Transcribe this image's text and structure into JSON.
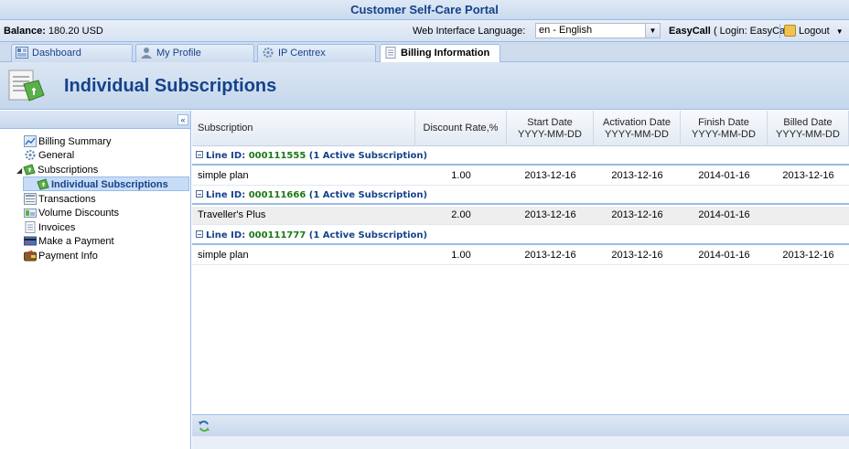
{
  "app": {
    "title": "Customer Self-Care Portal"
  },
  "topbar": {
    "balance_label": "Balance:",
    "balance_value": "180.20 USD",
    "language_label": "Web Interface Language:",
    "language_value": "en - English",
    "user_name": "EasyCall",
    "user_login": "( Login: EasyCall )",
    "logout_label": "Logout"
  },
  "tabs": [
    {
      "label": "Dashboard",
      "active": false
    },
    {
      "label": "My Profile",
      "active": false
    },
    {
      "label": "IP Centrex",
      "active": false
    },
    {
      "label": "Billing Information",
      "active": true
    }
  ],
  "page": {
    "title": "Individual Subscriptions"
  },
  "sidebar": {
    "collapse_label": "«",
    "items": [
      {
        "label": "Billing Summary",
        "icon": "chart-icon"
      },
      {
        "label": "General",
        "icon": "gear-icon"
      },
      {
        "label": "Subscriptions",
        "icon": "subscriptions-icon",
        "expanded": true
      },
      {
        "label": "Individual Subscriptions",
        "icon": "subscription-icon",
        "selected": true
      },
      {
        "label": "Transactions",
        "icon": "transactions-icon"
      },
      {
        "label": "Volume Discounts",
        "icon": "discount-icon"
      },
      {
        "label": "Invoices",
        "icon": "invoice-icon"
      },
      {
        "label": "Make a Payment",
        "icon": "payment-icon"
      },
      {
        "label": "Payment Info",
        "icon": "wallet-icon"
      }
    ]
  },
  "grid": {
    "columns": [
      {
        "label": "Subscription",
        "sub": ""
      },
      {
        "label": "Discount Rate,%",
        "sub": ""
      },
      {
        "label": "Start Date",
        "sub": "YYYY-MM-DD"
      },
      {
        "label": "Activation Date",
        "sub": "YYYY-MM-DD"
      },
      {
        "label": "Finish Date",
        "sub": "YYYY-MM-DD"
      },
      {
        "label": "Billed Date",
        "sub": "YYYY-MM-DD"
      }
    ],
    "groups": [
      {
        "prefix": "Line ID:",
        "line_id": "000111555",
        "suffix": "(1 Active Subscription)",
        "rows": [
          {
            "subscription": "simple plan",
            "discount": "1.00",
            "start": "2013-12-16",
            "activation": "2013-12-16",
            "finish": "2014-01-16",
            "billed": "2013-12-16"
          }
        ]
      },
      {
        "prefix": "Line ID:",
        "line_id": "000111666",
        "suffix": "(1 Active Subscription)",
        "rows": [
          {
            "subscription": "Traveller's Plus",
            "discount": "2.00",
            "start": "2013-12-16",
            "activation": "2013-12-16",
            "finish": "2014-01-16",
            "billed": ""
          }
        ]
      },
      {
        "prefix": "Line ID:",
        "line_id": "000111777",
        "suffix": "(1 Active Subscription)",
        "rows": [
          {
            "subscription": "simple plan",
            "discount": "1.00",
            "start": "2013-12-16",
            "activation": "2013-12-16",
            "finish": "2014-01-16",
            "billed": "2013-12-16"
          }
        ]
      }
    ]
  }
}
